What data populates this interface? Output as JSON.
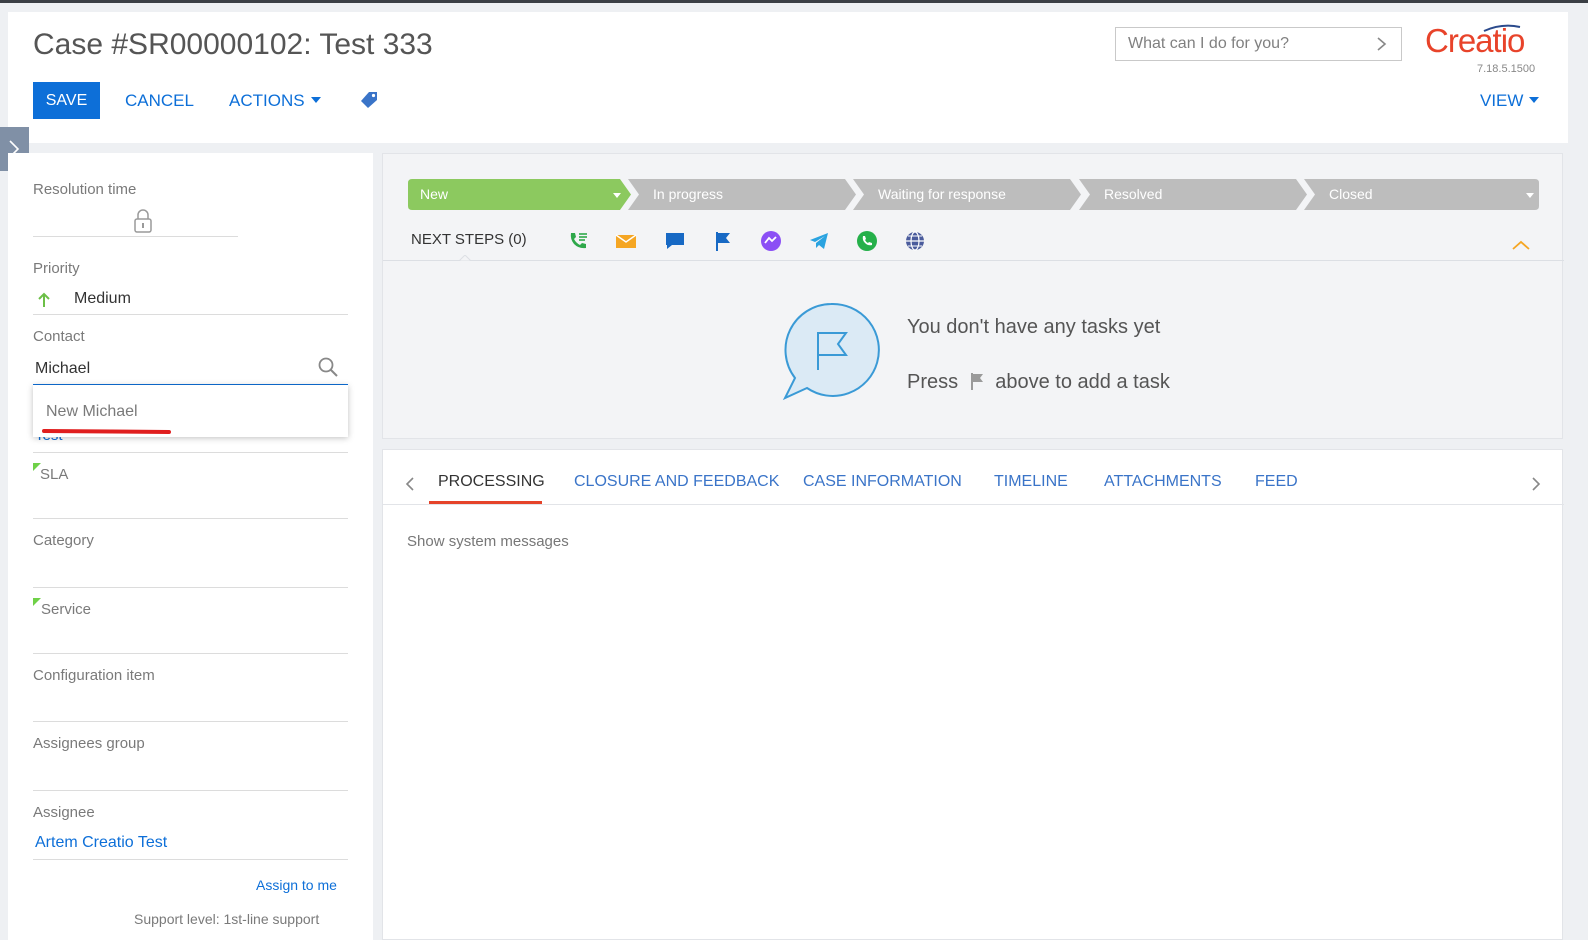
{
  "header": {
    "title": "Case #SR00000102: Test 333",
    "save_label": "SAVE",
    "cancel_label": "CANCEL",
    "actions_label": "ACTIONS",
    "view_label": "VIEW",
    "search_placeholder": "What can I do for you?",
    "logo_text": "Creatio",
    "version": "7.18.5.1500"
  },
  "left": {
    "resolution_label": "Resolution time",
    "priority_label": "Priority",
    "priority_value": "Medium",
    "contact_label": "Contact",
    "contact_value": "Michael",
    "dropdown_item": "New Michael",
    "peek_text": "Test",
    "sla_label": "SLA",
    "category_label": "Category",
    "service_label": "Service",
    "config_label": "Configuration item",
    "assignees_group_label": "Assignees group",
    "assignee_label": "Assignee",
    "assignee_value": "Artem Creatio Test",
    "assign_me": "Assign to me",
    "support_level": "Support level: 1st-line support"
  },
  "stages": [
    "New",
    "In progress",
    "Waiting for response",
    "Resolved",
    "Closed"
  ],
  "next_steps": {
    "label": "NEXT STEPS (0)",
    "icons": [
      "phone-icon",
      "email-icon",
      "chat-icon",
      "flag-icon",
      "messenger-icon",
      "telegram-icon",
      "whatsapp-icon",
      "globe-icon"
    ],
    "empty_title": "You don't have any tasks yet",
    "hint_before": "Press",
    "hint_after": "above to add a task"
  },
  "tabs": [
    "PROCESSING",
    "CLOSURE AND FEEDBACK",
    "CASE INFORMATION",
    "TIMELINE",
    "ATTACHMENTS",
    "FEED"
  ],
  "processing": {
    "system_messages": "Show system messages"
  },
  "colors": {
    "accent": "#0d6fd8",
    "brand": "#e8432a",
    "stage_active": "#8cc95f",
    "stage_inactive": "#bdbdbd"
  }
}
